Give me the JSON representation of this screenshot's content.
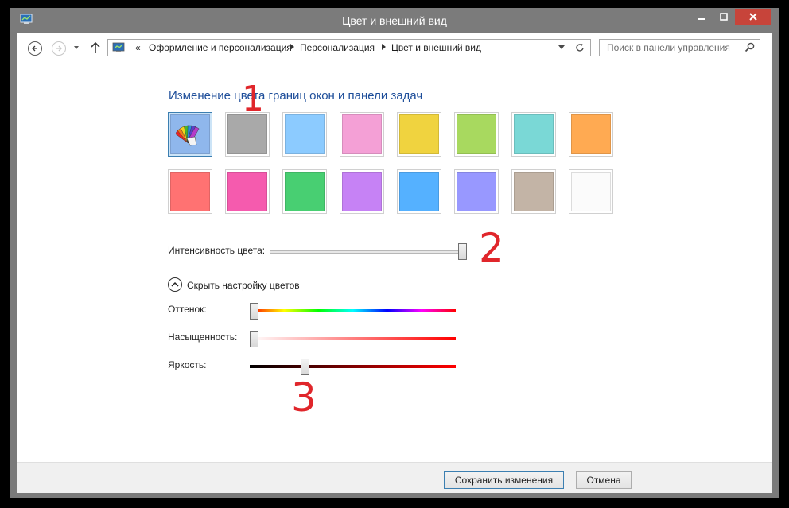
{
  "window": {
    "title": "Цвет и внешний вид",
    "close_color": "#c7443a"
  },
  "nav": {
    "chevrons": "«",
    "breadcrumbs": [
      "Оформление и персонализация",
      "Персонализация",
      "Цвет и внешний вид"
    ],
    "search_placeholder": "Поиск в панели управления"
  },
  "main": {
    "heading": "Изменение цвета границ окон и панели задач",
    "swatches": [
      {
        "name": "automatic",
        "color": "#8fb7ec",
        "selected": true
      },
      {
        "name": "gray",
        "color": "#a9a9a9"
      },
      {
        "name": "sky-blue",
        "color": "#8ccbff"
      },
      {
        "name": "pink",
        "color": "#f4a0d6"
      },
      {
        "name": "yellow",
        "color": "#f0d33f"
      },
      {
        "name": "lime",
        "color": "#a8d95f"
      },
      {
        "name": "teal",
        "color": "#7ad8d6"
      },
      {
        "name": "orange",
        "color": "#ffaa52"
      },
      {
        "name": "salmon",
        "color": "#ff7272"
      },
      {
        "name": "magenta",
        "color": "#f55bae"
      },
      {
        "name": "green",
        "color": "#48cf72"
      },
      {
        "name": "violet",
        "color": "#c682f5"
      },
      {
        "name": "blue",
        "color": "#55b1ff"
      },
      {
        "name": "periwinkle",
        "color": "#9898ff"
      },
      {
        "name": "taupe",
        "color": "#c3b4a6"
      },
      {
        "name": "white",
        "color": "#fbfbfb"
      }
    ],
    "intensity_label": "Интенсивность цвета:",
    "intensity_value": 1.0,
    "toggle_label": "Скрыть настройку цветов",
    "hue_label": "Оттенок:",
    "hue_value": 0.0,
    "saturation_label": "Насыщенность:",
    "saturation_value": 0.0,
    "brightness_label": "Яркость:",
    "brightness_value": 0.26
  },
  "annotations": [
    "1",
    "2",
    "3"
  ],
  "footer": {
    "save_label": "Сохранить изменения",
    "cancel_label": "Отмена"
  }
}
